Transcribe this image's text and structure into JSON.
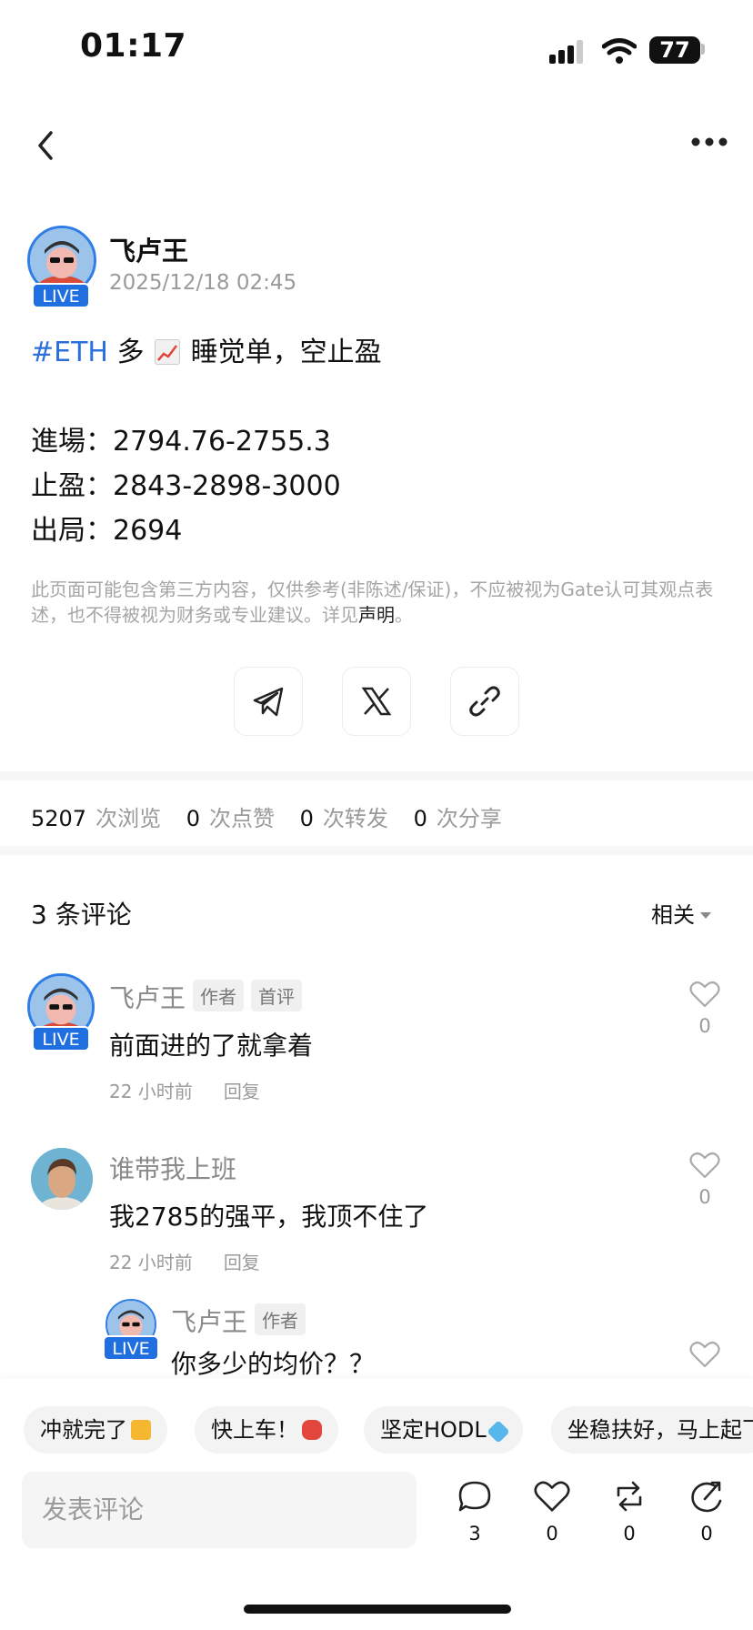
{
  "status_bar": {
    "time": "01:17",
    "battery": "77"
  },
  "post": {
    "author": "飞卢王",
    "live_label": "LIVE",
    "date": "2025/12/18 02:45",
    "hashtag": "#ETH",
    "headline_a": " 多",
    "headline_b": " 睡觉单，空止盈",
    "entry": "進場：2794.76-2755.3",
    "take_profit": "止盈：2843-2898-3000",
    "exit": "出局：2694",
    "disclaimer_text": "此页面可能包含第三方内容，仅供参考(非陈述/保证)，不应被视为Gate认可其观点表述，也不得被视为财务或专业建议。详见",
    "disclaimer_link": "声明",
    "disclaimer_end": "。"
  },
  "stats": {
    "views": "5207",
    "views_label": "次浏览",
    "likes": "0",
    "likes_label": "次点赞",
    "reposts": "0",
    "reposts_label": "次转发",
    "shares": "0",
    "shares_label": "次分享"
  },
  "comments_section": {
    "title": "3 条评论",
    "sort": "相关"
  },
  "comments": [
    {
      "name": "飞卢王",
      "tag1": "作者",
      "tag2": "首评",
      "text": "前面进的了就拿着",
      "time": "22 小时前",
      "reply": "回复",
      "likes": "0"
    },
    {
      "name": "谁带我上班",
      "text": "我2785的强平，我顶不住了",
      "time": "22 小时前",
      "reply": "回复",
      "likes": "0"
    },
    {
      "name": "飞卢王",
      "tag1": "作者",
      "text": "你多少的均价？？"
    }
  ],
  "quick_replies": [
    "冲就完了",
    "快上车！",
    "坚定HODL",
    "坐稳扶好，马上起飞"
  ],
  "bottom_bar": {
    "placeholder": "发表评论",
    "comment_count": "3",
    "like_count": "0",
    "repost_count": "0",
    "share_count": "0"
  }
}
